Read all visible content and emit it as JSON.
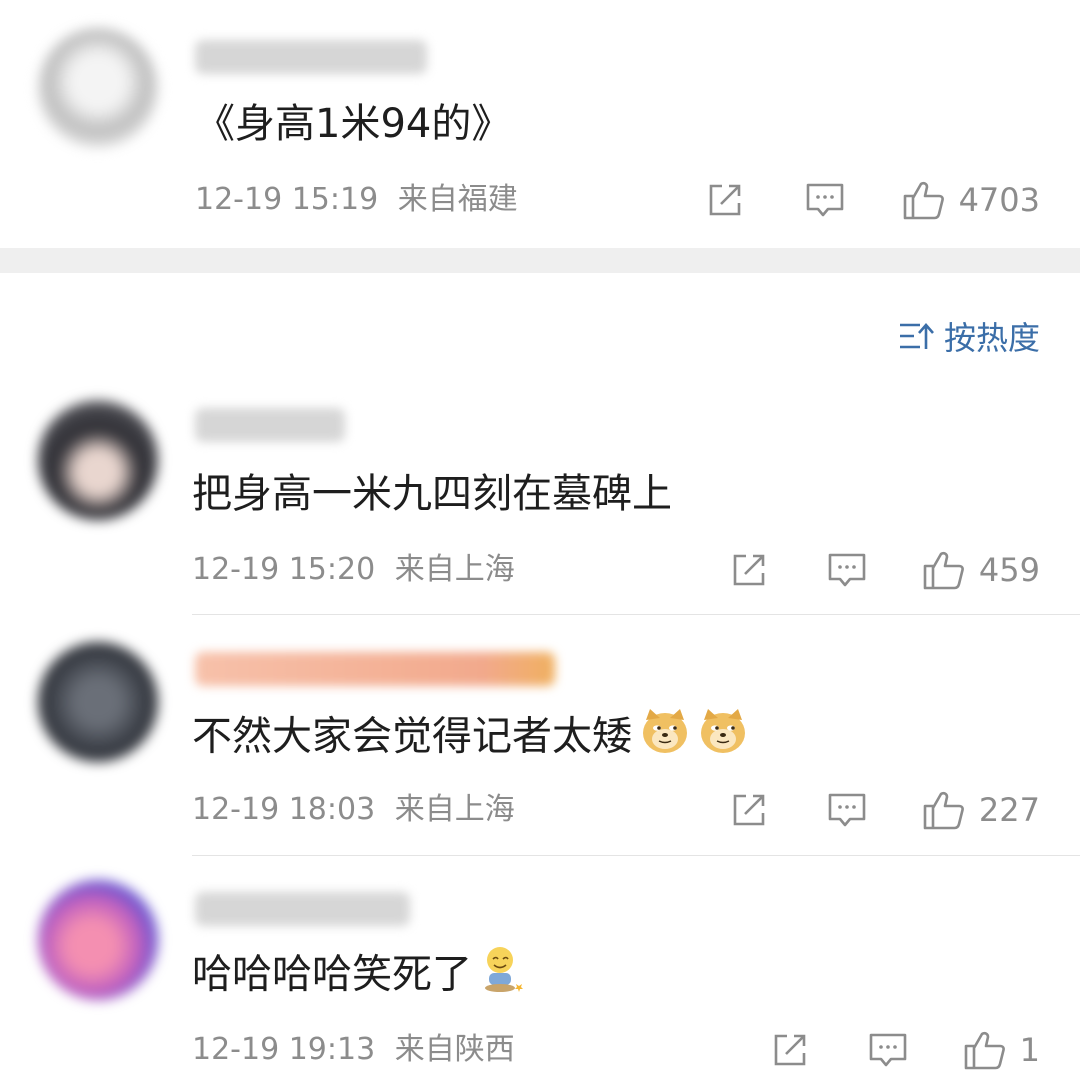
{
  "post": {
    "text": "《身高1米94的》",
    "time": "12-19 15:19",
    "location": "来自福建",
    "likes": "4703"
  },
  "sort": {
    "label": "按热度",
    "icon": "sort-icon"
  },
  "comments": [
    {
      "text": "把身高一米九四刻在墓碑上",
      "time": "12-19 15:20",
      "location": "来自上海",
      "likes": "459"
    },
    {
      "text": "不然大家会觉得记者太矮",
      "emoji": [
        "doge-emoji",
        "doge-emoji"
      ],
      "time": "12-19 18:03",
      "location": "来自上海",
      "likes": "227"
    },
    {
      "text": "哈哈哈哈笑死了",
      "emoji": [
        "grin-sitting-emoji"
      ],
      "time": "12-19 19:13",
      "location": "来自陕西",
      "likes": "1"
    }
  ],
  "colors": {
    "accent": "#3b6ea8",
    "meta": "#8c8c8c",
    "text": "#1e1e1e",
    "gap": "#efefef",
    "username_highlight": "#f0a070"
  }
}
